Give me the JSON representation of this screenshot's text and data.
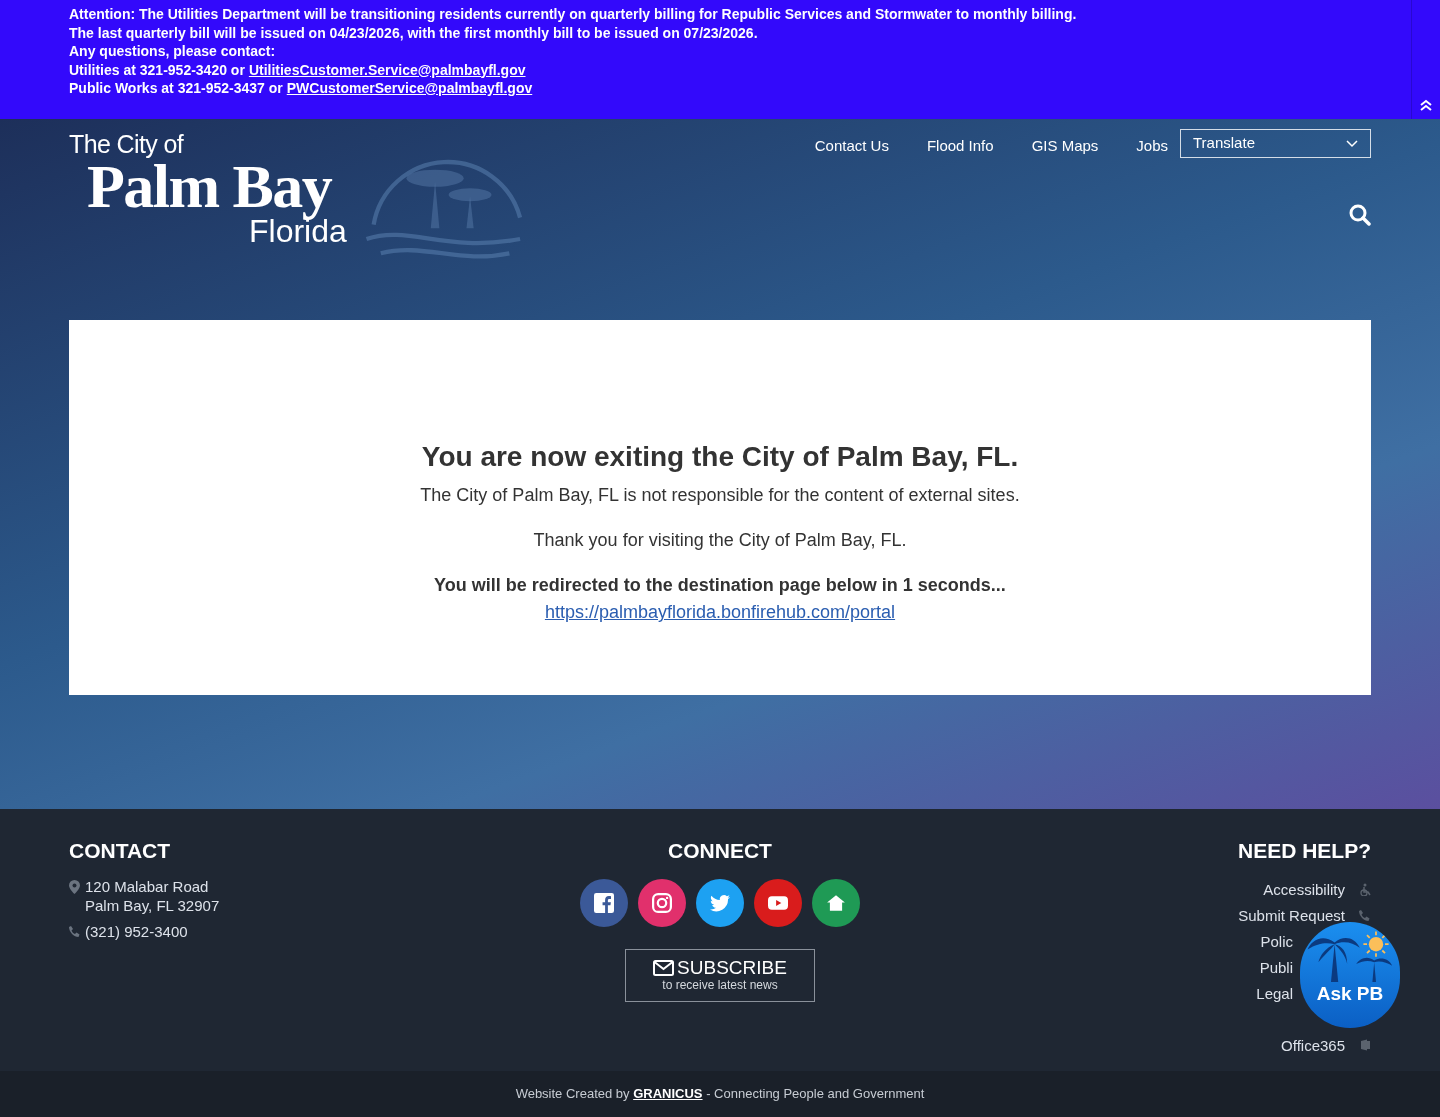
{
  "alert": {
    "lines": [
      {
        "text": "Attention: The Utilities Department will be transitioning residents currently on quarterly billing for Republic Services and Stormwater to monthly billing."
      },
      {
        "text": "The last quarterly bill will be issued on 04/23/2026, with the first monthly bill to be issued on 07/23/2026."
      },
      {
        "text": "Any questions, please contact:"
      },
      {
        "text": "Utilities at 321-952-3420 or",
        "link": "UtilitiesCustomer.Service@palmbayfl.gov"
      },
      {
        "text": "Public Works at 321-952-3437 or",
        "link": "PWCustomerService@palmbayfl.gov"
      }
    ]
  },
  "logo": {
    "line_1": "The City of",
    "line_2": "Palm Bay",
    "line_3": "Florida"
  },
  "nav": {
    "links": [
      "Contact Us",
      "Flood Info",
      "GIS Maps",
      "Jobs"
    ],
    "translate": "Translate"
  },
  "notice": {
    "heading": "You are now exiting the City of Palm Bay, FL.",
    "disclaimer": "The City of Palm Bay, FL is not responsible for the content of external sites.",
    "thanks": "Thank you for visiting the City of Palm Bay, FL.",
    "redirect": "You will be redirected to the destination page below in 1 seconds...",
    "url": "https://palmbayflorida.bonfirehub.com/portal"
  },
  "footer": {
    "contact": {
      "heading": "CONTACT",
      "address": [
        "120 Malabar Road",
        "Palm Bay, FL 32907"
      ],
      "phone": "(321) 952-3400"
    },
    "connect": {
      "heading": "CONNECT",
      "socials": [
        {
          "kind": "facebook",
          "color": "#3b5998"
        },
        {
          "kind": "instagram",
          "color": "#e1306c"
        },
        {
          "kind": "twitter",
          "color": "#1da1f2"
        },
        {
          "kind": "youtube",
          "color": "#d91c1c"
        },
        {
          "kind": "home",
          "color": "#1f9a55"
        }
      ],
      "subscribe": {
        "title": "SUBSCRIBE",
        "subtitle": "to receive latest news"
      }
    },
    "help": {
      "heading": "NEED HELP?",
      "items": [
        {
          "label": "Accessibility",
          "kind": "wheelchair"
        },
        {
          "label": "Submit Request",
          "kind": "phone"
        },
        {
          "label": "Polic",
          "kind": "covered"
        },
        {
          "label": "Publi",
          "kind": "covered"
        },
        {
          "label": "Legal",
          "kind": "covered"
        },
        {
          "label": "Office365",
          "kind": "office"
        }
      ]
    },
    "chat": {
      "label": "Ask PB"
    }
  },
  "credit": {
    "prefix": "Website Created by",
    "brand": "GRANICUS",
    "suffix": "- Connecting People and Government"
  }
}
